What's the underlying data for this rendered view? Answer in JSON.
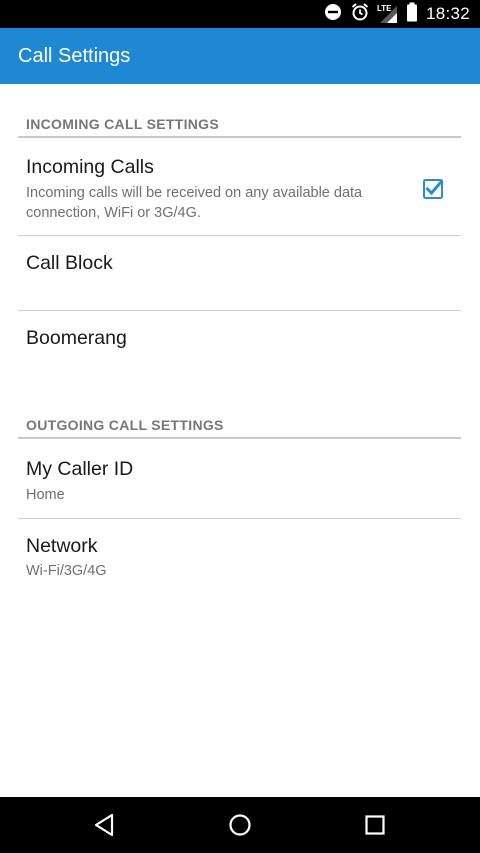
{
  "status_bar": {
    "time": "18:32",
    "icons": [
      "do-not-disturb-icon",
      "alarm-icon",
      "lte-signal-icon",
      "battery-icon"
    ],
    "network_label": "LTE"
  },
  "app_bar": {
    "title": "Call Settings",
    "color": "#1e88d3"
  },
  "sections": {
    "incoming": {
      "header": "INCOMING CALL SETTINGS",
      "items": {
        "incoming_calls": {
          "title": "Incoming Calls",
          "summary_line1": "Incoming calls will be received on any available data",
          "summary_line2": "connection, WiFi or 3G/4G.",
          "checked": true
        },
        "call_block": {
          "title": "Call Block"
        },
        "boomerang": {
          "title": "Boomerang"
        }
      }
    },
    "outgoing": {
      "header": "OUTGOING CALL SETTINGS",
      "items": {
        "caller_id": {
          "title": "My Caller ID",
          "summary": "Home"
        },
        "network": {
          "title": "Network",
          "summary": "Wi-Fi/3G/4G"
        }
      }
    }
  },
  "nav_bar": {
    "icons": [
      "back-icon",
      "home-icon",
      "recents-icon"
    ]
  },
  "accent_color": "#2a8bd6"
}
